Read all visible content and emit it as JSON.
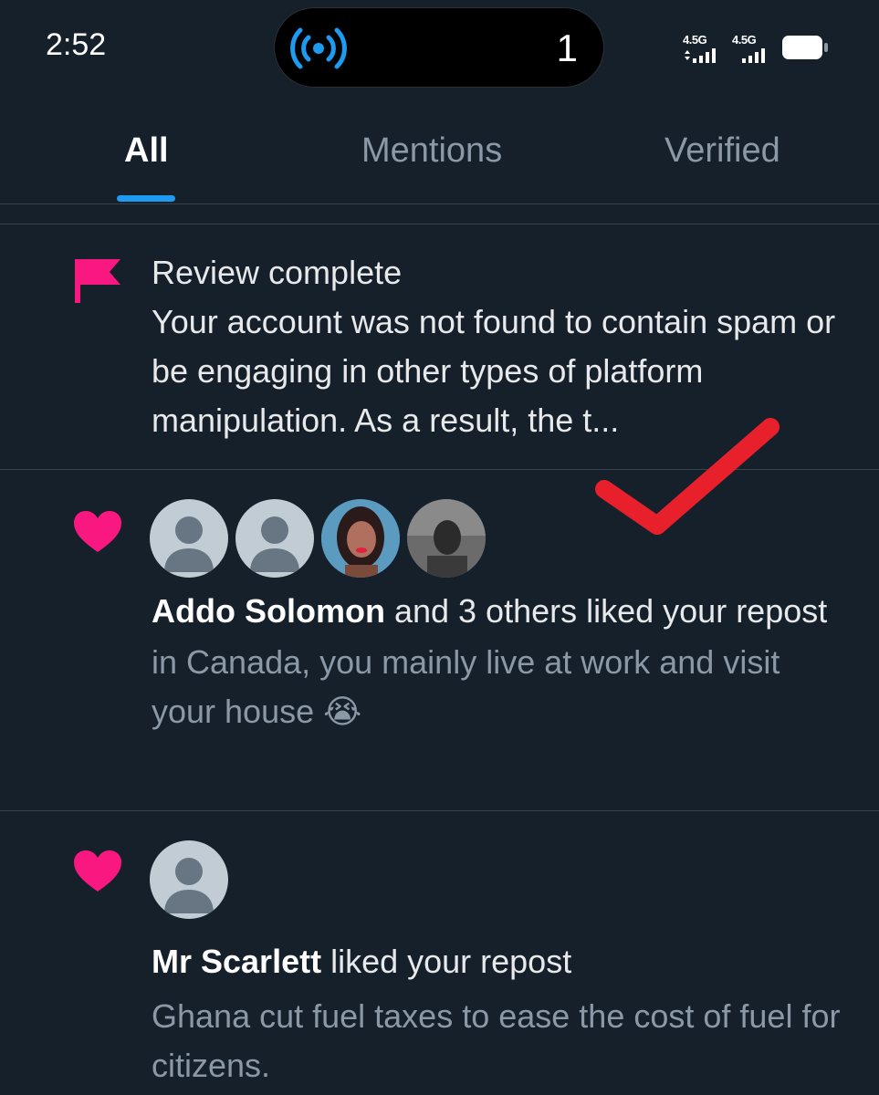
{
  "status_bar": {
    "time": "2:52",
    "island_count": "1",
    "network_1": "4.5G",
    "network_2": "4.5G"
  },
  "tabs": [
    {
      "label": "All",
      "active": true
    },
    {
      "label": "Mentions",
      "active": false
    },
    {
      "label": "Verified",
      "active": false
    }
  ],
  "notifications": [
    {
      "icon": "flag-icon",
      "title": "Review complete",
      "body": "Your account was not found to contain spam or be engaging in other types of platform manipulation. As a result, the t..."
    },
    {
      "icon": "heart-icon",
      "actor": "Addo Solomon",
      "action": " and 3 others liked your repost",
      "preview": "in Canada, you mainly live at work and visit your house 😭"
    },
    {
      "icon": "heart-icon",
      "actor": "Mr Scarlett",
      "action": " liked your repost",
      "preview": "Ghana cut fuel taxes to ease the cost of fuel for citizens."
    }
  ],
  "colors": {
    "background": "#15202b",
    "accent": "#1d9bf0",
    "pink": "#f91880",
    "annotation_check": "#e8202c"
  }
}
